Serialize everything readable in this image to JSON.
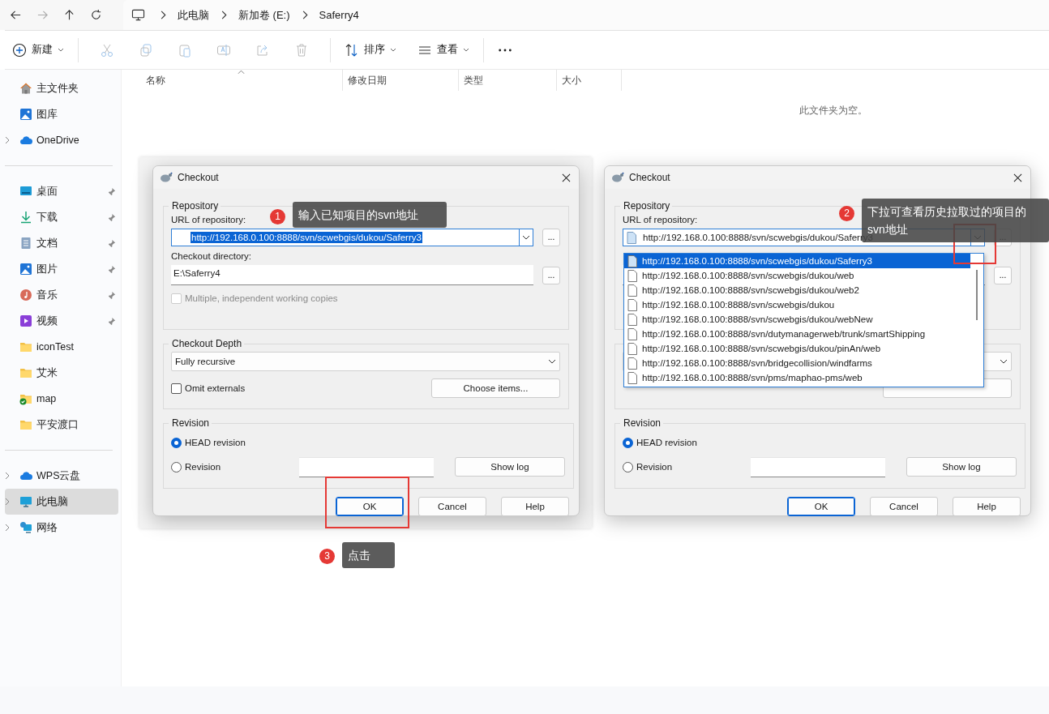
{
  "nav": {
    "breadcrumb": [
      "此电脑",
      "新加卷 (E:)",
      "Saferry4"
    ]
  },
  "toolbar": {
    "new_label": "新建",
    "sort_label": "排序",
    "view_label": "查看"
  },
  "sidebar": {
    "groups": [
      [
        {
          "label": "主文件夹",
          "expandable": false,
          "pinned": false,
          "selected": false
        },
        {
          "label": "图库",
          "expandable": false,
          "pinned": false,
          "selected": false
        },
        {
          "label": "OneDrive",
          "expandable": true,
          "pinned": false,
          "selected": false
        }
      ],
      [
        {
          "label": "桌面",
          "expandable": false,
          "pinned": true,
          "selected": false
        },
        {
          "label": "下载",
          "expandable": false,
          "pinned": true,
          "selected": false
        },
        {
          "label": "文档",
          "expandable": false,
          "pinned": true,
          "selected": false
        },
        {
          "label": "图片",
          "expandable": false,
          "pinned": true,
          "selected": false
        },
        {
          "label": "音乐",
          "expandable": false,
          "pinned": true,
          "selected": false
        },
        {
          "label": "视频",
          "expandable": false,
          "pinned": true,
          "selected": false
        },
        {
          "label": "iconTest",
          "expandable": false,
          "pinned": false,
          "selected": false
        },
        {
          "label": "艾米",
          "expandable": false,
          "pinned": false,
          "selected": false
        },
        {
          "label": "map",
          "expandable": false,
          "pinned": false,
          "selected": false
        },
        {
          "label": "平安渡口",
          "expandable": false,
          "pinned": false,
          "selected": false
        }
      ],
      [
        {
          "label": "WPS云盘",
          "expandable": true,
          "pinned": false,
          "selected": false
        },
        {
          "label": "此电脑",
          "expandable": true,
          "pinned": false,
          "selected": true
        },
        {
          "label": "网络",
          "expandable": true,
          "pinned": false,
          "selected": false
        }
      ]
    ]
  },
  "columns": [
    "名称",
    "修改日期",
    "类型",
    "大小"
  ],
  "empty_message": "此文件夹为空。",
  "dialogs": [
    {
      "title": "Checkout",
      "repository_title": "Repository",
      "url_label": "URL of repository:",
      "url_value": "http://192.168.0.100:8888/svn/scwebgis/dukou/Saferry3",
      "url_selected": true,
      "browse": "...",
      "directory_label": "Checkout directory:",
      "directory_value": "E:\\Saferry4",
      "directory_browse": "...",
      "multiple": {
        "label": "Multiple, independent working copies",
        "checked": false,
        "disabled": true
      },
      "depth_title": "Checkout Depth",
      "depth_value": "Fully recursive",
      "omit": {
        "label": "Omit externals",
        "checked": false
      },
      "choose_items": "Choose items...",
      "revision_title": "Revision",
      "revisions": [
        {
          "kind": "head",
          "label": "HEAD revision",
          "selected": true
        },
        {
          "kind": "number",
          "label": "Revision",
          "selected": false
        }
      ],
      "show_log": "Show log",
      "buttons": [
        {
          "label": "OK",
          "focused": true
        },
        {
          "label": "Cancel",
          "focused": false
        },
        {
          "label": "Help",
          "focused": false
        }
      ]
    },
    {
      "title": "Checkout",
      "repository_title": "Repository",
      "url_label": "URL of repository:",
      "url_value": "http://192.168.0.100:8888/svn/scwebgis/dukou/Saferry3",
      "url_selected": false,
      "browse": "...",
      "directory_browse": "...",
      "revision_title": "Revision",
      "revisions": [
        {
          "kind": "head",
          "label": "HEAD revision",
          "selected": true
        },
        {
          "kind": "number",
          "label": "Revision",
          "selected": false
        }
      ],
      "show_log": "Show log",
      "buttons": [
        {
          "label": "OK",
          "focused": true
        },
        {
          "label": "Cancel",
          "focused": false
        },
        {
          "label": "Help",
          "focused": false
        }
      ],
      "history": [
        {
          "url": "http://192.168.0.100:8888/svn/scwebgis/dukou/Saferry3",
          "selected": true
        },
        {
          "url": "http://192.168.0.100:8888/svn/scwebgis/dukou/web",
          "selected": false
        },
        {
          "url": "http://192.168.0.100:8888/svn/scwebgis/dukou/web2",
          "selected": false
        },
        {
          "url": "http://192.168.0.100:8888/svn/scwebgis/dukou",
          "selected": false
        },
        {
          "url": "http://192.168.0.100:8888/svn/scwebgis/dukou/webNew",
          "selected": false
        },
        {
          "url": "http://192.168.0.100:8888/svn/dutymanagerweb/trunk/smartShipping",
          "selected": false
        },
        {
          "url": "http://192.168.0.100:8888/svn/scwebgis/dukou/pinAn/web",
          "selected": false
        },
        {
          "url": "http://192.168.0.100:8888/svn/bridgecollision/windfarms",
          "selected": false
        },
        {
          "url": "http://192.168.0.100:8888/svn/pms/maphao-pms/web",
          "selected": false
        }
      ]
    }
  ],
  "annotations": [
    {
      "number": "1",
      "text": "输入已知项目的svn地址"
    },
    {
      "number": "2",
      "text": "下拉可查看历史拉取过的项目的svn地址"
    },
    {
      "number": "3",
      "text": "点击"
    }
  ]
}
